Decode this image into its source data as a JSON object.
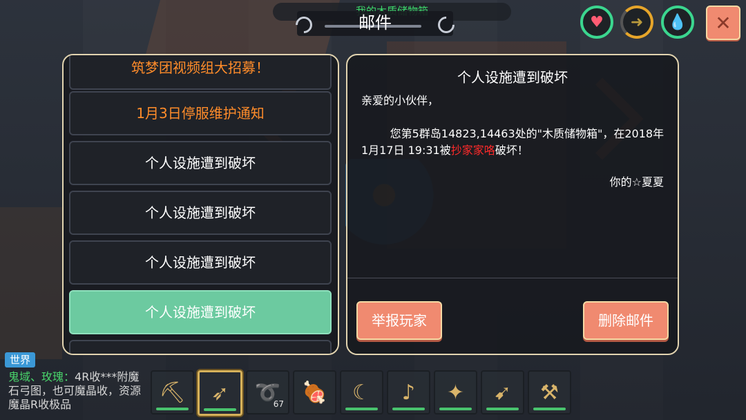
{
  "top": {
    "progress_text": "我的木质储物箱",
    "title": "邮件"
  },
  "status": {
    "heart_icon": "♥",
    "food_icon": "➜",
    "water_icon": "💧",
    "close_label": "✕"
  },
  "mail_list": {
    "items": [
      {
        "label": "筑梦团视频组大招募！",
        "style": "orange"
      },
      {
        "label": "1月3日停服维护通知",
        "style": "orange"
      },
      {
        "label": "个人设施遭到破坏",
        "style": "normal"
      },
      {
        "label": "个人设施遭到破坏",
        "style": "normal"
      },
      {
        "label": "个人设施遭到破坏",
        "style": "normal"
      },
      {
        "label": "个人设施遭到破坏",
        "style": "selected"
      }
    ]
  },
  "detail": {
    "title": "个人设施遭到破坏",
    "greeting": "亲爱的小伙伴，",
    "body_part1": "您第5群岛14823,14463处的\"木质储物箱\"，在2018年1月17日 19:31被",
    "body_red": "抄家家咯",
    "body_part2": "破坏！",
    "signature": "你的☆夏夏",
    "report_button": "举报玩家",
    "delete_button": "删除邮件"
  },
  "chat": {
    "channel": "世界",
    "sender": "鬼域、玫瑰：",
    "message": "4R收***附魔石弓图，也可魔晶收，资源魔晶R收极品"
  },
  "hotbar": {
    "slots": [
      {
        "icon": "pickaxe-icon",
        "glyph": "⛏",
        "count": ""
      },
      {
        "icon": "bow-icon",
        "glyph": "➶",
        "count": ""
      },
      {
        "icon": "whip-icon",
        "glyph": "➰",
        "count": "67"
      },
      {
        "icon": "food-icon",
        "glyph": "🍖",
        "count": ""
      },
      {
        "icon": "sickle-icon",
        "glyph": "☾",
        "count": ""
      },
      {
        "icon": "horn-icon",
        "glyph": "♪",
        "count": ""
      },
      {
        "icon": "staff-icon",
        "glyph": "✦",
        "count": ""
      },
      {
        "icon": "crossbow-icon",
        "glyph": "➹",
        "count": ""
      },
      {
        "icon": "axe-icon",
        "glyph": "⚒",
        "count": ""
      }
    ],
    "active_index": 1
  }
}
